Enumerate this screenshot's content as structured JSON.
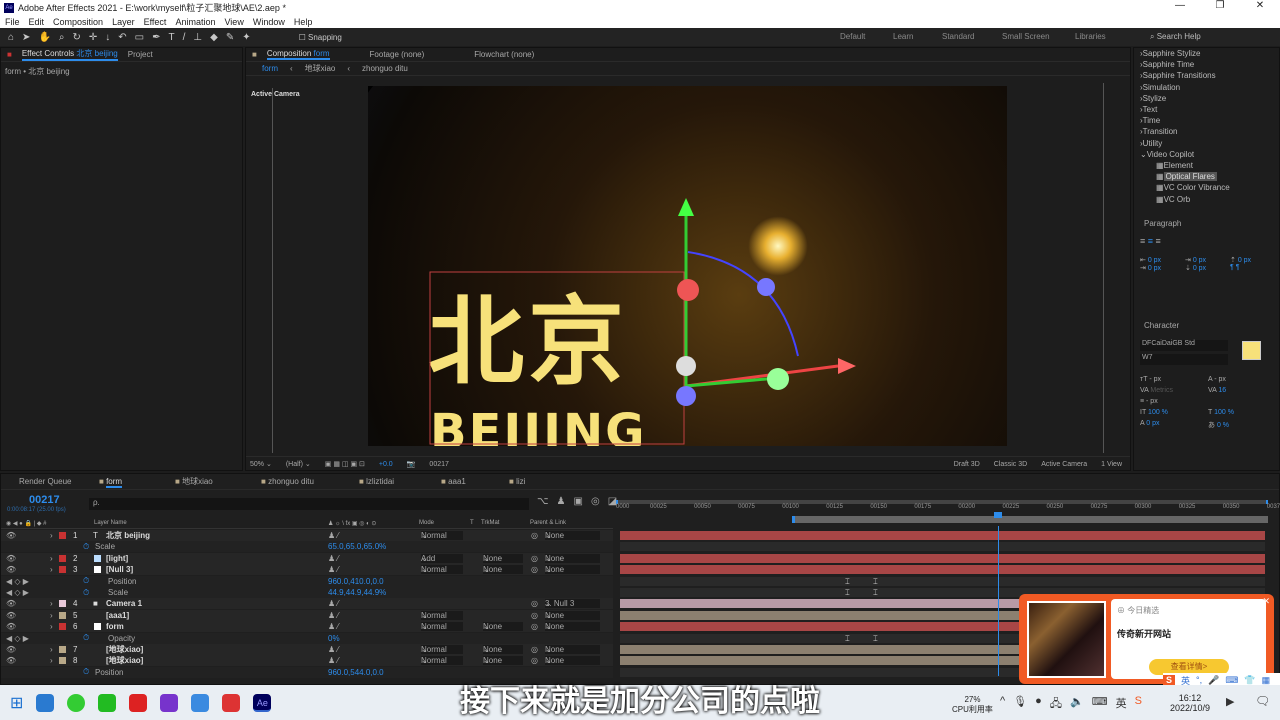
{
  "window": {
    "title": "Adobe After Effects 2021 - E:\\work\\myself\\粒子汇聚地球\\AE\\2.aep *",
    "logo": "Ae",
    "controls": [
      "—",
      "❐",
      "✕"
    ]
  },
  "menu": [
    "File",
    "Edit",
    "Composition",
    "Layer",
    "Effect",
    "Animation",
    "View",
    "Window",
    "Help"
  ],
  "toolbar": {
    "snapping": "Snapping",
    "workspaces": [
      "Default",
      "Learn",
      "Standard",
      "Small Screen",
      "Libraries"
    ],
    "search_placeholder": "Search Help"
  },
  "left_panel": {
    "tabs": [
      "Effect Controls",
      "Project"
    ],
    "effect_target": "北京 beijing",
    "breadcrumb": "form • 北京 beijing"
  },
  "comp_panel": {
    "tabs": [
      "Composition",
      "Footage (none)",
      "Flowchart (none)"
    ],
    "comp_name": "form",
    "nav": [
      "form",
      "地球xiao",
      "zhonguo ditu"
    ],
    "camera_label": "Active Camera",
    "overlay_text_cn": "北京",
    "overlay_text_en": "BEIJING",
    "viewer_bar": {
      "zoom": "50%",
      "resolution": "(Half)",
      "exposure": "+0.0",
      "timecode": "00217",
      "renderer_label": "Draft 3D",
      "renderer": "Classic 3D",
      "camera": "Active Camera",
      "views": "1 View"
    }
  },
  "effects_panel": {
    "items": [
      "Sapphire Stylize",
      "Sapphire Time",
      "Sapphire Transitions",
      "Simulation",
      "Stylize",
      "Text",
      "Time",
      "Transition",
      "Utility",
      "Video Copilot"
    ],
    "sub_items": [
      "Element",
      "Optical Flares",
      "VC Color Vibrance",
      "VC Orb"
    ],
    "selected": "Optical Flares"
  },
  "paragraph_panel": {
    "title": "Paragraph",
    "values": [
      "0 px",
      "0 px",
      "0 px",
      "0 px",
      "0 px"
    ]
  },
  "character_panel": {
    "title": "Character",
    "font": "DFCaiDaiGB Std",
    "style": "W7",
    "size": "- px",
    "leading": "- px",
    "kerning": "Metrics",
    "tracking": "16",
    "line": "- px",
    "vscale": "100 %",
    "hscale": "100 %",
    "baseline": "0 px",
    "tsume": "0 %",
    "fill_color": "#f7e17a"
  },
  "timeline": {
    "tabs": [
      "Render Queue",
      "form",
      "地球xiao",
      "zhonguo ditu",
      "lzliztidai",
      "aaa1",
      "lizi"
    ],
    "timecode": "00217",
    "timecode_sub": "0:00:08:17 (25.00 fps)",
    "search_placeholder": "ρ.",
    "headers": {
      "layer_name": "Layer Name",
      "mode": "Mode",
      "t": "T",
      "trkmat": "TrkMat",
      "parent": "Parent & Link"
    },
    "ruler": [
      "0000",
      "00025",
      "00050",
      "00075",
      "00100",
      "00125",
      "00150",
      "00175",
      "00200",
      "00225",
      "00250",
      "00275",
      "00300",
      "00325",
      "00350",
      "0037"
    ],
    "current_frame": 217,
    "work_area_start": 100,
    "duration": 370,
    "rows": [
      {
        "num": "1",
        "name": "北京 beijing",
        "type": "T",
        "color": "#c83232",
        "mode": "Normal",
        "trk": "",
        "parent": "None",
        "bar": "#a84646",
        "layer": true
      },
      {
        "prop": "Scale",
        "value": "65.0,65.0,65.0%"
      },
      {
        "num": "2",
        "name": "[light]",
        "type": "solid",
        "color": "#c83232",
        "swatch": "#bdf",
        "mode": "Add",
        "trk": "None",
        "parent": "None",
        "bar": "#a84646",
        "layer": true
      },
      {
        "num": "3",
        "name": "[Null 3]",
        "type": "null",
        "color": "#c83232",
        "swatch": "#fff",
        "mode": "Normal",
        "trk": "None",
        "parent": "None",
        "bar": "#a84646",
        "layer": true
      },
      {
        "prop": "Position",
        "value": "960.0,410.0,0.0",
        "keys": true
      },
      {
        "prop": "Scale",
        "value": "44.9,44.9,44.9%",
        "keys": true
      },
      {
        "num": "4",
        "name": "Camera 1",
        "type": "cam",
        "color": "#e8c8d8",
        "mode": "",
        "trk": "",
        "parent": "3. Null 3",
        "bar": "#b89aa6",
        "layer": true
      },
      {
        "num": "5",
        "name": "[aaa1]",
        "type": "comp",
        "color": "#b8a888",
        "mode": "Normal",
        "trk": "",
        "parent": "None",
        "bar": "#8c8070",
        "layer": true
      },
      {
        "num": "6",
        "name": "form",
        "type": "solid",
        "color": "#c83232",
        "swatch": "#fff",
        "mode": "Normal",
        "trk": "None",
        "parent": "None",
        "bar": "#a84646",
        "layer": true
      },
      {
        "prop": "Opacity",
        "value": "0%",
        "keys": true
      },
      {
        "num": "7",
        "name": "[地球xiao]",
        "type": "comp",
        "color": "#b8a888",
        "mode": "Normal",
        "trk": "None",
        "parent": "None",
        "bar": "#8c8070",
        "layer": true
      },
      {
        "num": "8",
        "name": "[地球xiao]",
        "type": "comp",
        "color": "#b8a888",
        "mode": "Normal",
        "trk": "None",
        "parent": "None",
        "bar": "#8c8070",
        "layer": true
      },
      {
        "prop": "Position",
        "value": "960.0,544.0,0.0"
      }
    ]
  },
  "subtitle": "接下来就是加分公司的点啦",
  "ad": {
    "label": "今日精选",
    "headline": "传奇新开网站",
    "button": "查看详情>"
  },
  "ime": {
    "lang": "英"
  },
  "taskbar": {
    "cpu_pct": "27%",
    "cpu_label": "CPU利用率",
    "time": "16:12",
    "date": "2022/10/9",
    "lang": "英"
  }
}
